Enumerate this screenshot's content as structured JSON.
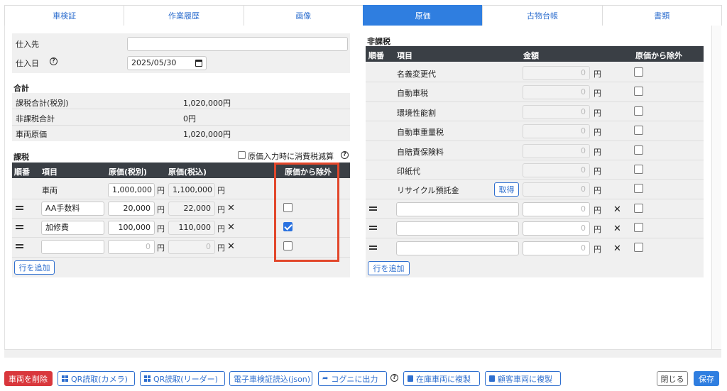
{
  "tabs": [
    "車検証",
    "作業履歴",
    "画像",
    "原価",
    "古物台帳",
    "書類"
  ],
  "active_tab": 3,
  "purchase": {
    "supplier_label": "仕入先",
    "supplier_value": "",
    "date_label": "仕入日",
    "date_value": "2025/05/30"
  },
  "totals": {
    "title": "合計",
    "rows": [
      {
        "label": "課税合計(税別)",
        "value": "1,020,000円"
      },
      {
        "label": "非課税合計",
        "value": "0円"
      },
      {
        "label": "車両原価",
        "value": "1,020,000円"
      }
    ]
  },
  "taxable": {
    "title": "課税",
    "reduce_label": "原価入力時に消費税減算",
    "headers": [
      "順番",
      "項目",
      "原価(税別)",
      "原価(税込)",
      "原価から除外"
    ],
    "unit": "円",
    "rows": [
      {
        "item": "車両",
        "ex_tax": "1,000,000",
        "in_tax": "1,100,000",
        "excluded": null
      },
      {
        "item": "AA手数料",
        "ex_tax": "20,000",
        "in_tax": "22,000",
        "excluded": false
      },
      {
        "item": "加修費",
        "ex_tax": "100,000",
        "in_tax": "110,000",
        "excluded": true
      },
      {
        "item": "",
        "ex_tax": "0",
        "in_tax": "0",
        "excluded": false
      }
    ],
    "add_row": "行を追加"
  },
  "nontaxable": {
    "title": "非課税",
    "headers": [
      "順番",
      "項目",
      "金額",
      "原価から除外"
    ],
    "unit": "円",
    "fetch_label": "取得",
    "fixed_rows": [
      {
        "item": "名義変更代",
        "amount": "0"
      },
      {
        "item": "自動車税",
        "amount": "0"
      },
      {
        "item": "環境性能割",
        "amount": "0"
      },
      {
        "item": "自動車重量税",
        "amount": "0"
      },
      {
        "item": "自賠責保険料",
        "amount": "0"
      },
      {
        "item": "印紙代",
        "amount": "0"
      },
      {
        "item": "リサイクル預託金",
        "amount": "0"
      }
    ],
    "custom_rows": [
      {
        "item": "",
        "amount": "0"
      },
      {
        "item": "",
        "amount": "0"
      },
      {
        "item": "",
        "amount": "0"
      }
    ],
    "add_row": "行を追加"
  },
  "footer": {
    "delete": "車両を削除",
    "qr_camera": "QR読取(カメラ)",
    "qr_reader": "QR読取(リーダー)",
    "ecert": "電子車検証読込(json)",
    "export": "コグニに出力",
    "copy_stock": "在庫車両に複製",
    "copy_customer": "顧客車両に複製",
    "close": "閉じる",
    "save": "保存"
  },
  "colors": {
    "accent": "#2f7ee0",
    "danger": "#d9373c",
    "highlight": "#e2472b",
    "table_header": "#3a3f45"
  }
}
